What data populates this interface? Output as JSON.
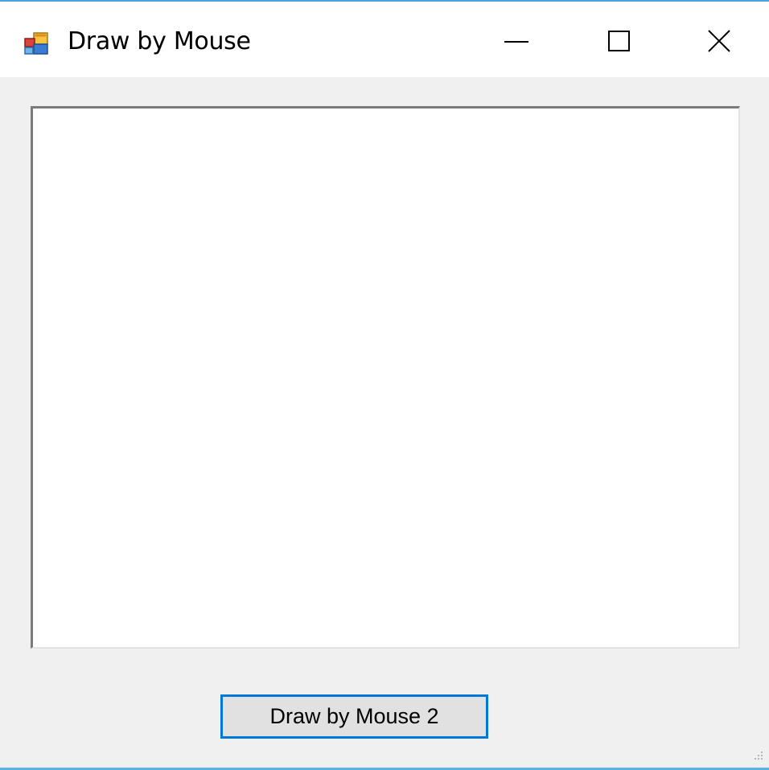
{
  "window": {
    "title": "Draw by Mouse",
    "icon": "windows-form-icon",
    "controls": {
      "minimize": "minimize-icon",
      "maximize": "maximize-icon",
      "close": "close-icon"
    }
  },
  "main": {
    "canvas": "drawing-panel",
    "button_label": "Draw by Mouse 2"
  },
  "colors": {
    "accent": "#0078d7",
    "window_border": "#4aa3df",
    "form_background": "#f0f0f0",
    "button_face": "#e1e1e1"
  }
}
